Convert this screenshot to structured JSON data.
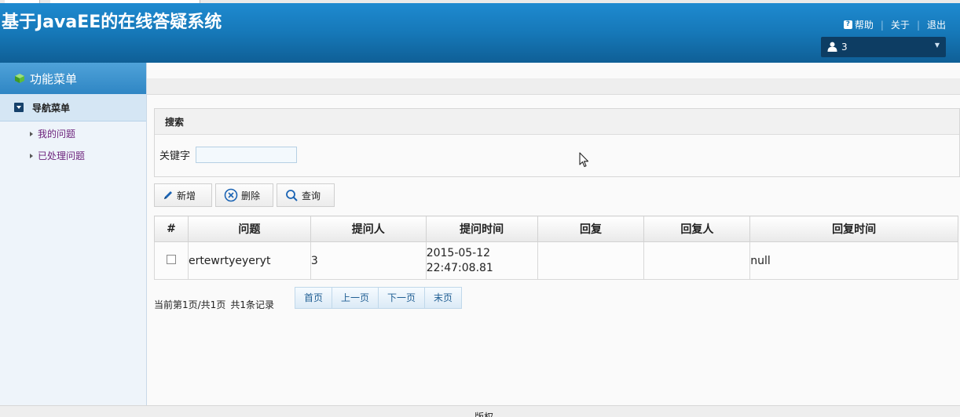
{
  "header": {
    "title": "基于JavaEE的在线答疑系统",
    "links": {
      "help": "帮助",
      "about": "关于",
      "logout": "退出"
    },
    "user": {
      "name": "3"
    }
  },
  "sidebar": {
    "title": "功能菜单",
    "nav_title": "导航菜单",
    "items": [
      {
        "label": "我的问题"
      },
      {
        "label": "已处理问题"
      }
    ]
  },
  "search": {
    "title": "搜索",
    "keyword_label": "关键字",
    "keyword_value": ""
  },
  "toolbar": {
    "add": "新增",
    "delete": "删除",
    "query": "查询"
  },
  "table": {
    "columns": [
      "#",
      "问题",
      "提问人",
      "提问时间",
      "回复",
      "回复人",
      "回复时间"
    ],
    "rows": [
      {
        "question": "ertewrtyeyeryt",
        "asker": "3",
        "ask_date": "2015-05-12",
        "ask_clock": "22:47:08.81",
        "reply": "",
        "replier": "",
        "reply_time": "null"
      }
    ]
  },
  "pager": {
    "info_page": "当前第1页/共1页",
    "info_total": "共1条记录",
    "first": "首页",
    "prev": "上一页",
    "next": "下一页",
    "last": "末页"
  },
  "footer": {
    "text": "版权"
  },
  "colors": {
    "header_blue": "#1678b8",
    "user_box": "#0d3d63",
    "link_purple": "#6b1f7a"
  },
  "icons": [
    "help-icon",
    "user-icon",
    "chevron-down-icon",
    "cube-icon",
    "collapse-icon",
    "pencil-icon",
    "delete-circle-icon",
    "search-icon",
    "mouse-cursor-icon"
  ]
}
